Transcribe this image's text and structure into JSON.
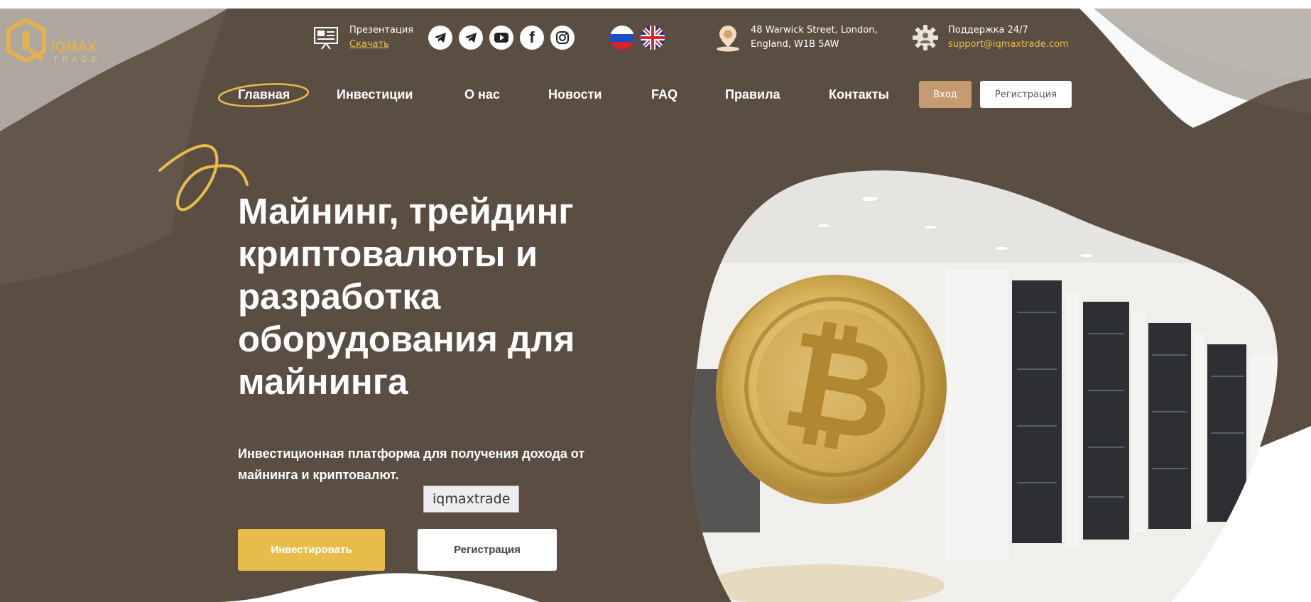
{
  "logo": {
    "text": "IQMAX",
    "sub": "TRADE"
  },
  "presentation": {
    "title": "Презентация",
    "link": "Скачать",
    "icon": "presentation-board-icon"
  },
  "socials": [
    {
      "name": "telegram-icon"
    },
    {
      "name": "telegram-icon"
    },
    {
      "name": "youtube-icon"
    },
    {
      "name": "facebook-icon"
    },
    {
      "name": "instagram-icon"
    }
  ],
  "languages": [
    {
      "name": "russia-flag-icon"
    },
    {
      "name": "uk-flag-icon"
    }
  ],
  "address": {
    "line1": "48 Warwick Street, London,",
    "line2": "England, W1B 5AW",
    "icon": "location-pin-icon"
  },
  "support": {
    "title": "Поддержка 24/7",
    "email": "support@iqmaxtrade.com",
    "icon": "support-gear-icon"
  },
  "nav": {
    "items": [
      "Главная",
      "Инвестиции",
      "О нас",
      "Новости",
      "FAQ",
      "Правила",
      "Контакты"
    ],
    "active": "Главная",
    "login": "Вход",
    "register": "Регистрация"
  },
  "hero": {
    "headline_lines": [
      "Майнинг, трейдинг",
      "криптовалюты и",
      "разработка",
      "оборудования для",
      "майнинга"
    ],
    "subtitle_lines": [
      "Инвестиционная платформа для получения дохода от",
      "майнинга и криптовалют."
    ],
    "tooltip": "iqmaxtrade",
    "invest_button": "Инвестировать",
    "register_button": "Регистрация"
  },
  "colors": {
    "brown": "#5a4e42",
    "accent_gold": "#e8bc4a",
    "login_tan": "#c59c72"
  }
}
